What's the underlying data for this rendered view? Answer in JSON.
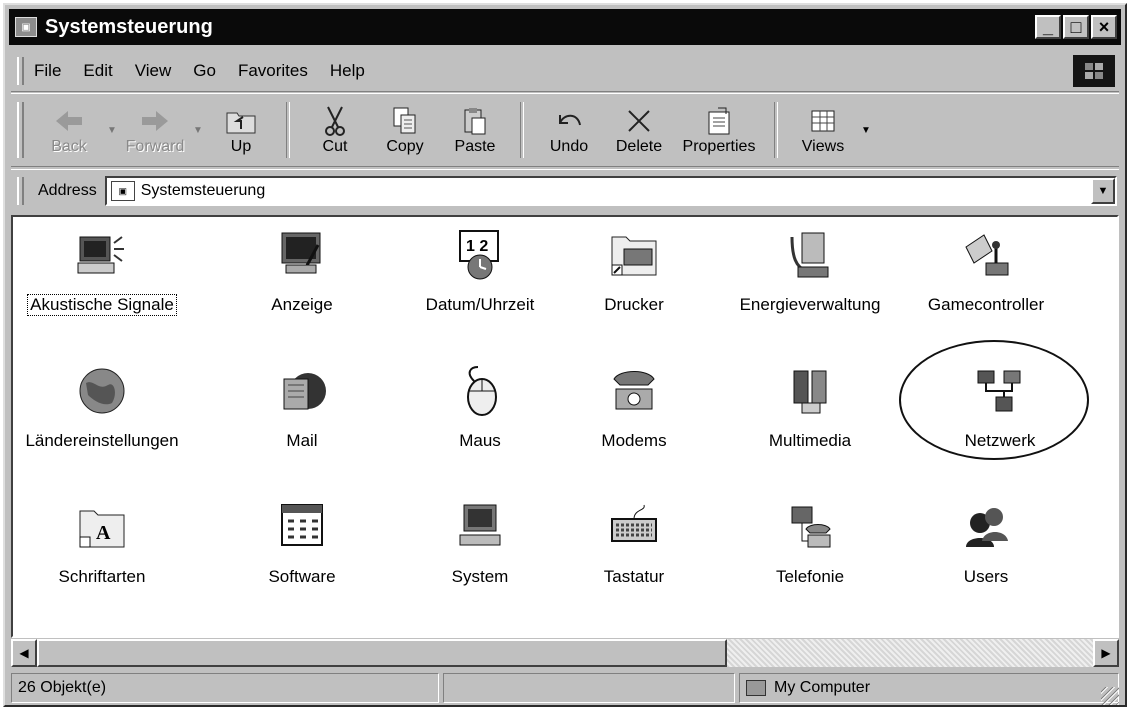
{
  "window": {
    "title": "Systemsteuerung"
  },
  "menu": [
    "File",
    "Edit",
    "View",
    "Go",
    "Favorites",
    "Help"
  ],
  "toolbar": {
    "back": "Back",
    "forward": "Forward",
    "up": "Up",
    "cut": "Cut",
    "copy": "Copy",
    "paste": "Paste",
    "undo": "Undo",
    "delete": "Delete",
    "properties": "Properties",
    "views": "Views"
  },
  "address": {
    "label": "Address",
    "value": "Systemsteuerung"
  },
  "items": [
    "Akustische Signale",
    "Anzeige",
    "Datum/Uhrzeit",
    "Drucker",
    "Energieverwaltung",
    "Gamecontroller",
    "Ländereinstellungen",
    "Mail",
    "Maus",
    "Modems",
    "Multimedia",
    "Netzwerk",
    "Schriftarten",
    "Software",
    "System",
    "Tastatur",
    "Telefonie",
    "Users"
  ],
  "status": {
    "count": "26 Objekt(e)",
    "location": "My Computer"
  }
}
